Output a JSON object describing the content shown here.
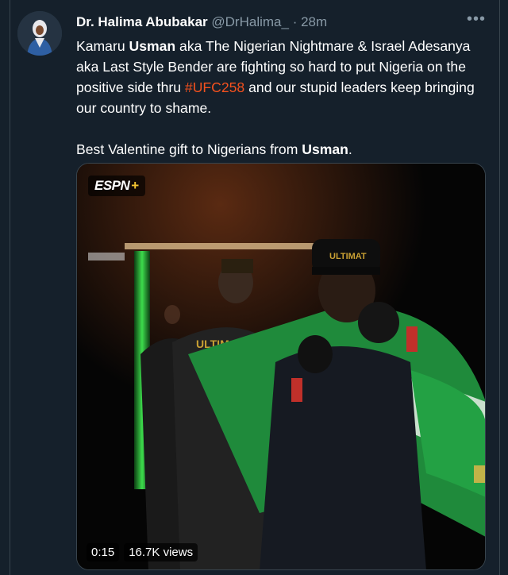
{
  "tweet": {
    "author_name": "Dr. Halima Abubakar",
    "author_handle": "@DrHalima_",
    "separator": "·",
    "time": "28m",
    "more_icon": "more-horizontal-icon",
    "paragraph1": {
      "part1": "Kamaru ",
      "bold1": "Usman",
      "part2": " aka The Nigerian Nightmare & Israel Adesanya aka Last Style Bender are fighting so hard to put Nigeria on the positive side thru  ",
      "hashtag": "#UFC258",
      "part3": " and our stupid leaders keep bringing our country to shame."
    },
    "paragraph2": {
      "part1": "Best Valentine gift to Nigerians from ",
      "bold1": "Usman",
      "part2": "."
    }
  },
  "video": {
    "badge": "ESPN",
    "badge_plus": "+",
    "duration": "0:15",
    "views": "16.7K views"
  },
  "colors": {
    "background": "#15202b",
    "secondary_text": "#8899a6",
    "hashtag": "#f4511e",
    "flag_green": "#1f8a3b"
  }
}
